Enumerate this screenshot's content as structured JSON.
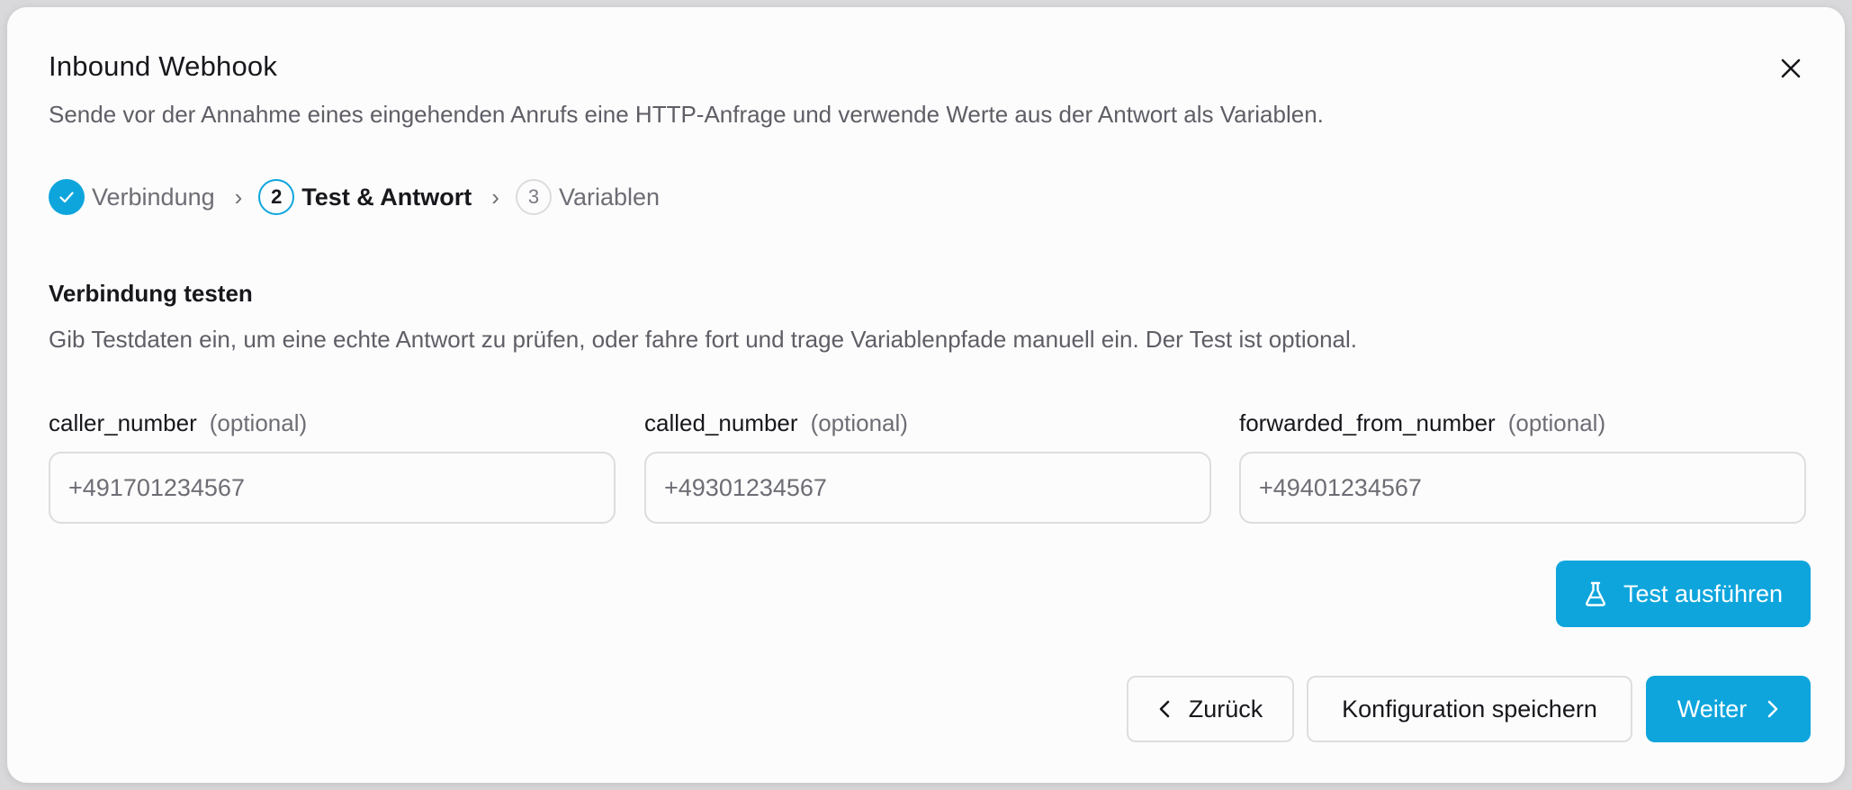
{
  "dialog": {
    "title": "Inbound Webhook",
    "subtitle": "Sende vor der Annahme eines eingehenden Anrufs eine HTTP-Anfrage und verwende Werte aus der Antwort als Variablen.",
    "close_icon": "close-icon"
  },
  "stepper": {
    "separator": "›",
    "steps": [
      {
        "number": "1",
        "label": "Verbindung",
        "state": "done"
      },
      {
        "number": "2",
        "label": "Test & Antwort",
        "state": "active"
      },
      {
        "number": "3",
        "label": "Variablen",
        "state": "pending"
      }
    ]
  },
  "section": {
    "title": "Verbindung testen",
    "description": "Gib Testdaten ein, um eine echte Antwort zu prüfen, oder fahre fort und trage Variablenpfade manuell ein. Der Test ist optional."
  },
  "fields": [
    {
      "name": "caller_number",
      "optional_label": "(optional)",
      "value": "",
      "placeholder": "+491701234567"
    },
    {
      "name": "called_number",
      "optional_label": "(optional)",
      "value": "",
      "placeholder": "+49301234567"
    },
    {
      "name": "forwarded_from_number",
      "optional_label": "(optional)",
      "value": "",
      "placeholder": "+49401234567"
    }
  ],
  "actions": {
    "test_label": "Test ausführen",
    "test_icon": "flask-icon",
    "back_label": "Zurück",
    "back_icon": "chevron-left-icon",
    "save_label": "Konfiguration speichern",
    "next_label": "Weiter",
    "next_icon": "chevron-right-icon"
  },
  "colors": {
    "accent": "#0ea5dd",
    "text_primary": "#17171c",
    "text_muted": "#5e5e66",
    "border": "#dddde0",
    "surface": "#fcfcfc",
    "backdrop": "#d9d9db"
  }
}
